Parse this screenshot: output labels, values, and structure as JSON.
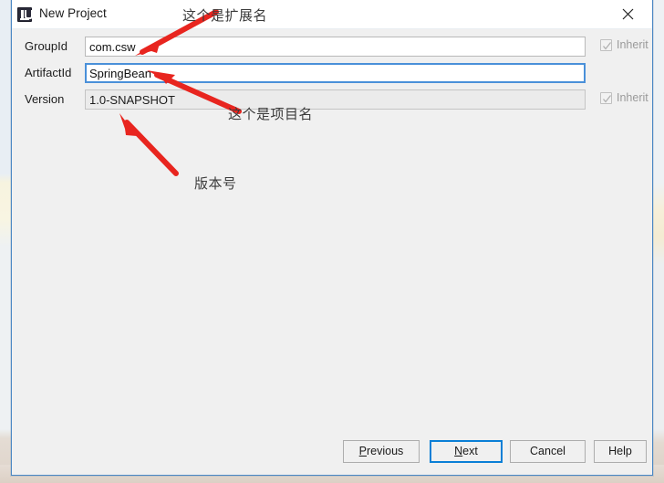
{
  "window": {
    "title": "New Project",
    "app_icon": "intellij-idea-icon",
    "close_icon": "close-icon"
  },
  "form": {
    "rows": [
      {
        "label": "GroupId",
        "value": "com.csw",
        "state": "normal",
        "inherit": {
          "label": "Inherit",
          "checked": true,
          "enabled": false
        }
      },
      {
        "label": "ArtifactId",
        "value": "SpringBean",
        "state": "focused",
        "inherit": null
      },
      {
        "label": "Version",
        "value": "1.0-SNAPSHOT",
        "state": "disabled",
        "inherit": {
          "label": "Inherit",
          "checked": true,
          "enabled": false
        }
      }
    ]
  },
  "buttons": {
    "previous": {
      "pre": "P",
      "mnemonic": "",
      "rest": "revious",
      "label": "Previous"
    },
    "next": {
      "pre": "",
      "mnemonic": "N",
      "rest": "ext",
      "label": "Next",
      "default": true
    },
    "cancel": {
      "label": "Cancel"
    },
    "help": {
      "label": "Help"
    }
  },
  "annotations": [
    {
      "id": "anno-1",
      "text": "这个是扩展名",
      "points_to": "groupid-input"
    },
    {
      "id": "anno-2",
      "text": "这个是项目名",
      "points_to": "artifactid-input"
    },
    {
      "id": "anno-3",
      "text": "版本号",
      "points_to": "version-input"
    }
  ],
  "annotation_color": "#e8251f"
}
